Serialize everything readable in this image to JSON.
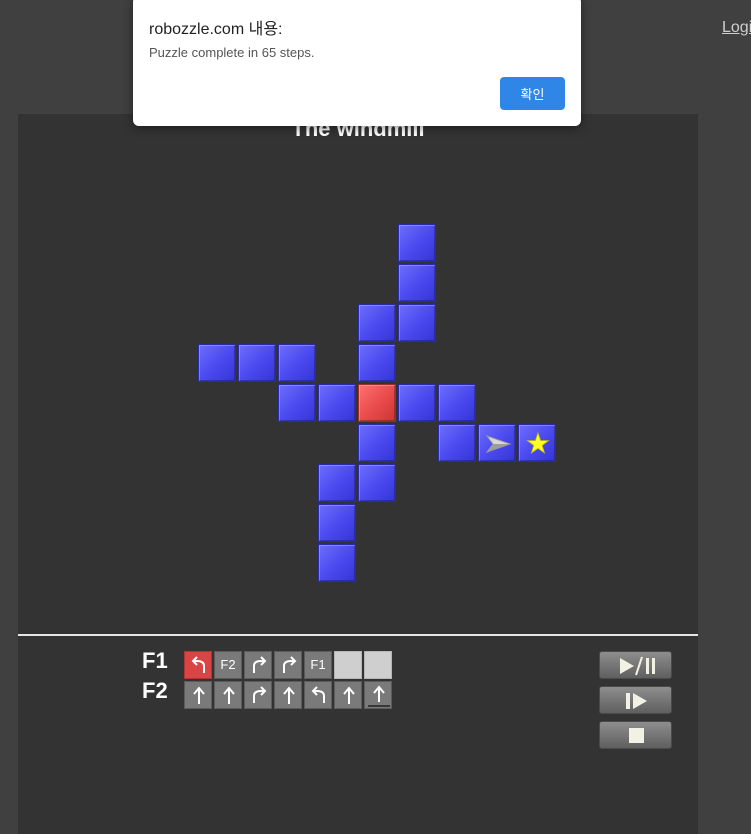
{
  "page": {
    "login_label": "Login",
    "background": "#404040",
    "panel_color": "#333333"
  },
  "puzzle": {
    "title": "The windmill",
    "tile_color": "#4848ee",
    "red_tile_color": "#e84a4a",
    "robot_direction": "right",
    "robot_icon": "arrow-ship-icon",
    "star_icon": "star-icon",
    "grid": [
      "......B...",
      "......B...",
      ".....BB...",
      ".BBB.B....",
      "...BBRBB..",
      ".....B.BAS",
      "....BB....",
      "....B.....",
      "....B....."
    ],
    "grid_legend": {
      "B": "blue tile",
      "R": "red tile",
      "A": "robot on blue tile",
      "S": "star on blue tile",
      ".": "empty"
    }
  },
  "program": {
    "functions": [
      {
        "label": "F1",
        "slots": [
          {
            "type": "turn-left-icon",
            "color": "red",
            "text": ""
          },
          {
            "type": "call",
            "color": "gray",
            "text": "F2"
          },
          {
            "type": "turn-right-icon",
            "color": "gray",
            "text": ""
          },
          {
            "type": "turn-right-icon",
            "color": "gray",
            "text": ""
          },
          {
            "type": "call",
            "color": "gray",
            "text": "F1"
          },
          {
            "type": "empty",
            "color": "empty",
            "text": ""
          },
          {
            "type": "empty",
            "color": "empty",
            "text": ""
          }
        ]
      },
      {
        "label": "F2",
        "slots": [
          {
            "type": "forward-icon",
            "color": "gray",
            "text": ""
          },
          {
            "type": "forward-icon",
            "color": "gray",
            "text": ""
          },
          {
            "type": "turn-right-icon",
            "color": "gray",
            "text": ""
          },
          {
            "type": "forward-icon",
            "color": "gray",
            "text": ""
          },
          {
            "type": "turn-left-icon",
            "color": "gray",
            "text": ""
          },
          {
            "type": "forward-icon",
            "color": "gray",
            "text": ""
          },
          {
            "type": "forward-cursor-icon",
            "color": "gray",
            "text": ""
          }
        ]
      }
    ]
  },
  "controls": {
    "play_pause_icon": "play-pause-icon",
    "step_icon": "step-icon",
    "stop_icon": "stop-icon"
  },
  "alert": {
    "title": "robozzle.com 내용:",
    "message": "Puzzle complete in 65 steps.",
    "ok_label": "확인",
    "ok_color": "#2f86e6"
  }
}
